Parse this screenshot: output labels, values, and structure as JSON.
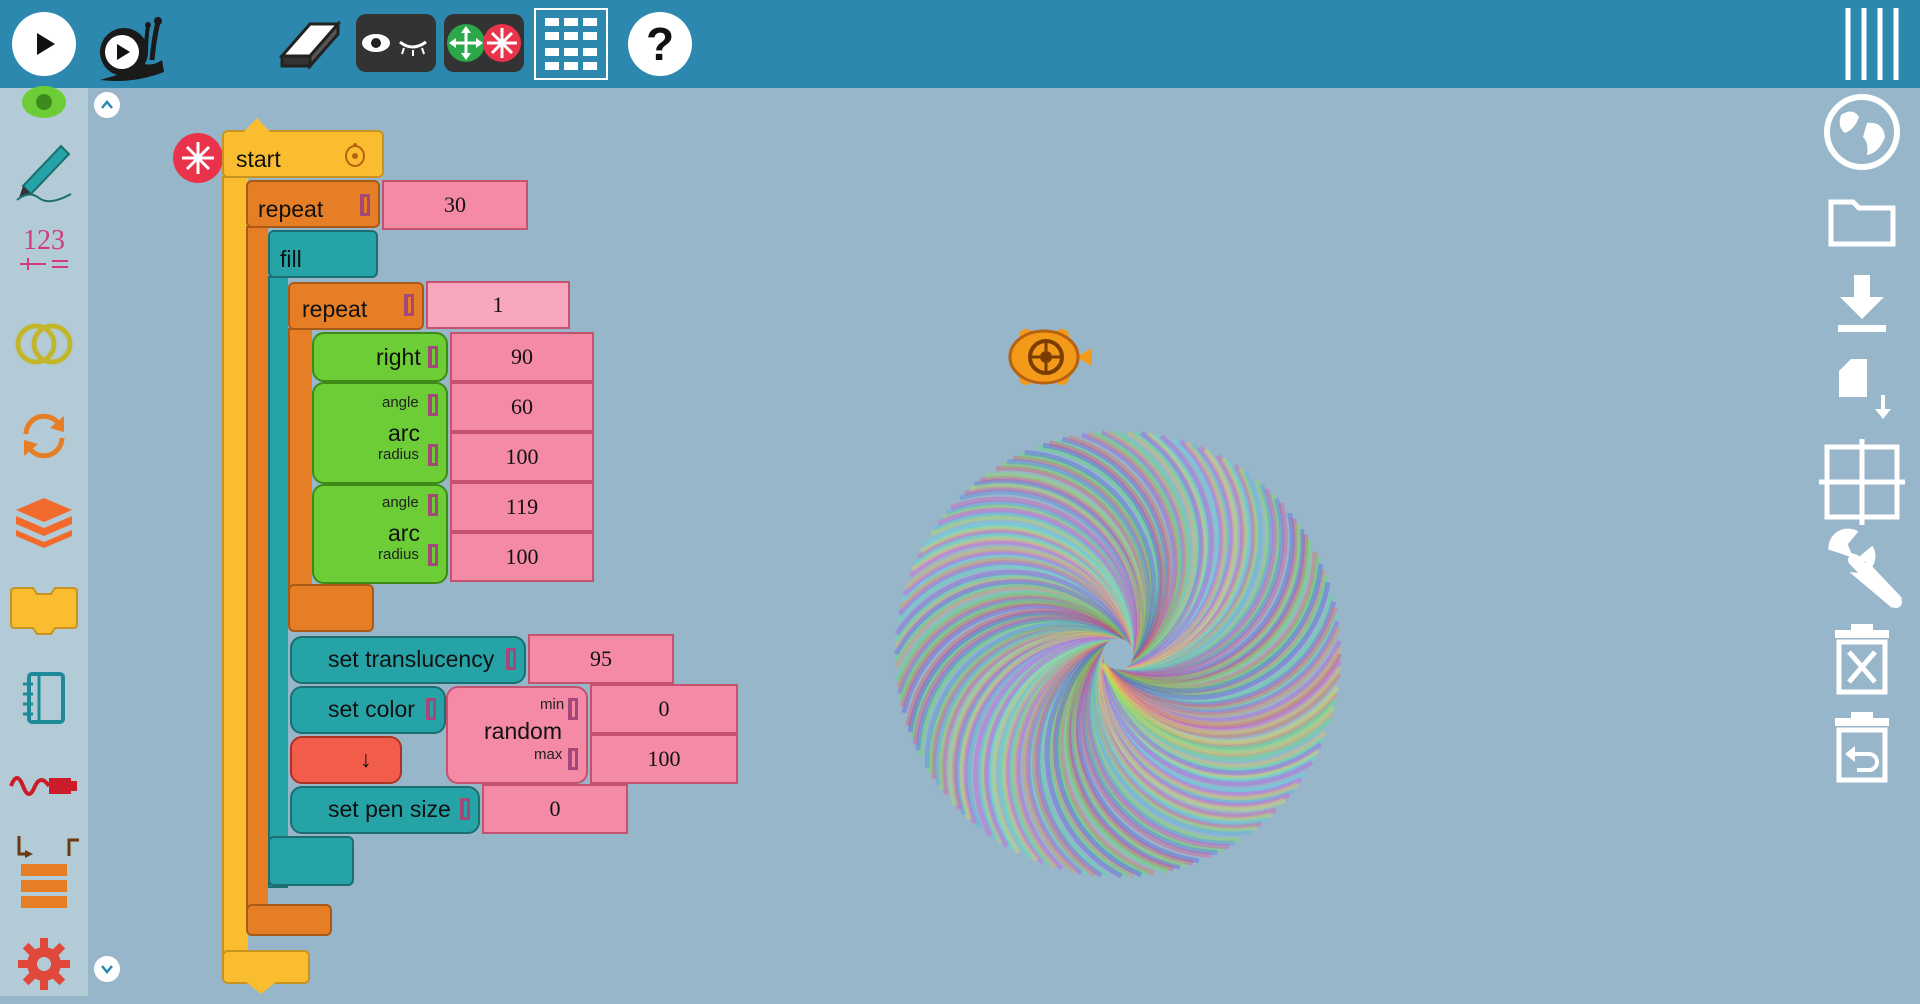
{
  "toolbar": {
    "run": "run-fast",
    "run_slow": "run-slow",
    "erase": "eraser",
    "hide_show": "hide-blocks",
    "collapse": "collapse-expand",
    "block_grid": "block-grid",
    "help": "?"
  },
  "palette": {
    "items": [
      "turtle",
      "pen",
      "number",
      "boolean",
      "flow",
      "box",
      "action",
      "media",
      "sensor",
      "heap",
      "extras"
    ],
    "number_label": "123"
  },
  "blocks": {
    "start": "start",
    "repeat1": "repeat",
    "repeat1_value": "30",
    "fill": "fill",
    "repeat2": "repeat",
    "repeat2_value": "1",
    "right": "right",
    "right_value": "90",
    "arc1": "arc",
    "arc1_angle_label": "angle",
    "arc1_angle": "60",
    "arc1_radius_label": "radius",
    "arc1_radius": "100",
    "arc2": "arc",
    "arc2_angle_label": "angle",
    "arc2_angle": "119",
    "arc2_radius_label": "radius",
    "arc2_radius": "100",
    "translucency": "set translucency",
    "translucency_value": "95",
    "set_color": "set color",
    "random": "random",
    "random_min_label": "min",
    "random_min": "0",
    "random_max_label": "max",
    "random_max": "100",
    "pen_down": "↓",
    "pen_size": "set pen size",
    "pen_size_value": "0"
  },
  "aux": {
    "items": [
      "menu",
      "language",
      "open",
      "save",
      "save-as",
      "grid",
      "settings",
      "clear",
      "restore"
    ]
  },
  "colors": {
    "topbar": "#2d88b0",
    "canvas": "#98b6ca",
    "palette": "#b2cbd7",
    "start": "#fbbd30",
    "flow": "#e57e25",
    "pen": "#25a3a6",
    "turtle": "#6dcd36",
    "number": "#f48aa5"
  }
}
